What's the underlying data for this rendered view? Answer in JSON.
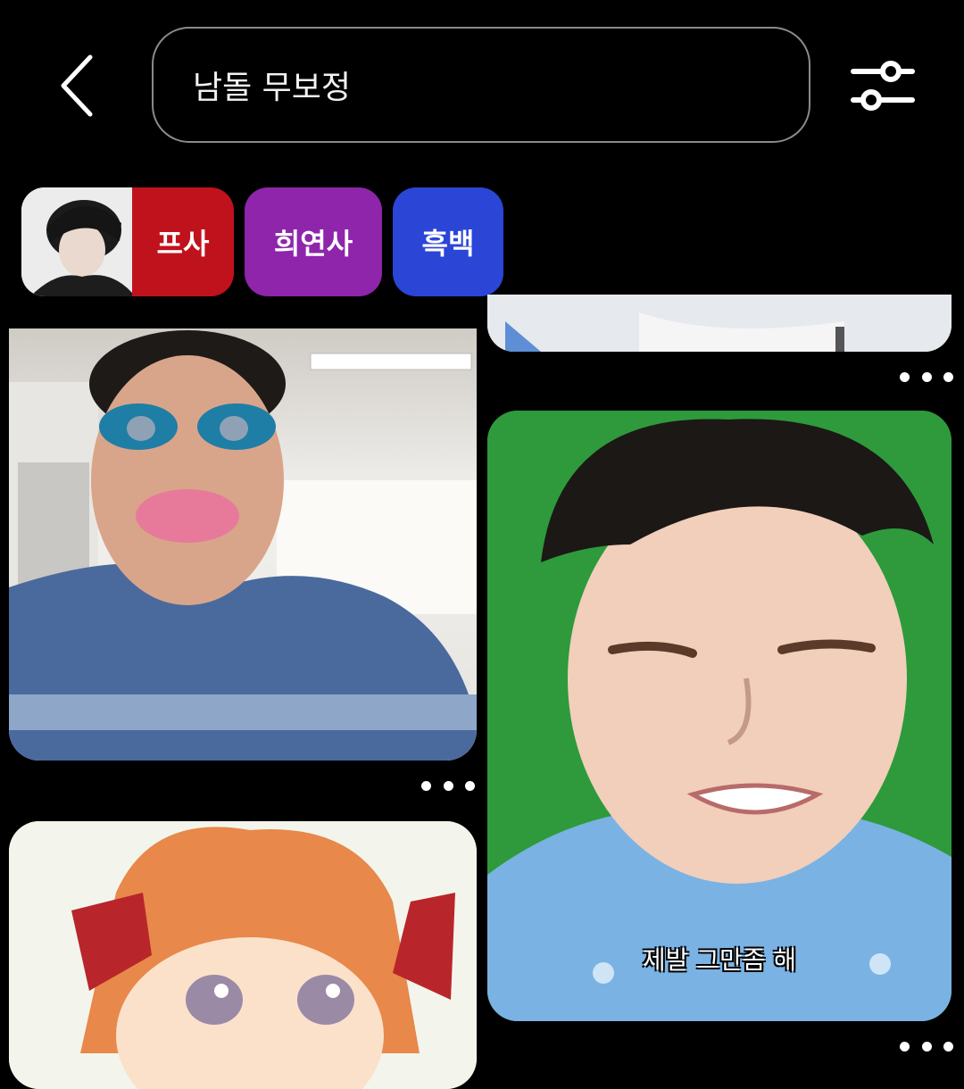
{
  "search": {
    "query": "남돌 무보정",
    "back_icon": "chevron-left-icon",
    "filter_icon": "sliders-icon"
  },
  "chips": [
    {
      "label": "프사",
      "color": "#c0121c",
      "has_thumbnail": true
    },
    {
      "label": "희연사",
      "color": "#8e25ab"
    },
    {
      "label": "흑백",
      "color": "#2b45d6"
    }
  ],
  "pins": [
    {
      "kind": "photo",
      "subject": "selfie with face filter"
    },
    {
      "kind": "illustration",
      "subject": "anime girl with polka-dot bows"
    },
    {
      "kind": "photo",
      "subject": "partially scrolled image"
    },
    {
      "kind": "photo",
      "subject": "boy crying on green screen",
      "caption": "제발 그만좀 해"
    }
  ],
  "more_icon": "more-horizontal-icon"
}
